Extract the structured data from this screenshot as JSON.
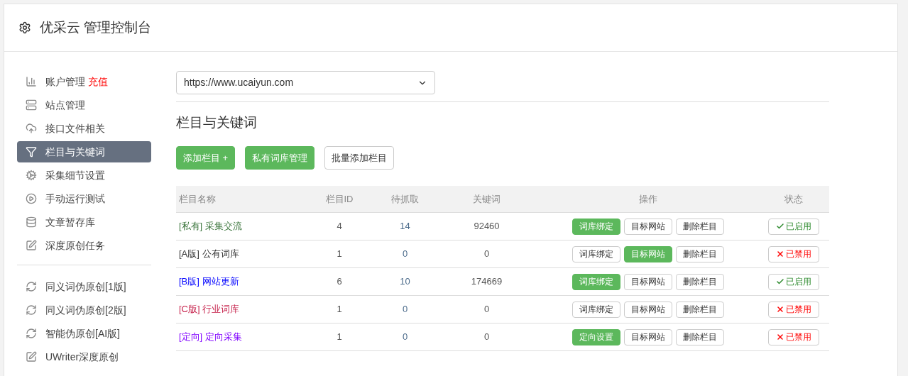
{
  "header": {
    "title": "优采云 管理控制台"
  },
  "sidebar": {
    "groups": [
      {
        "items": [
          {
            "label": "账户管理",
            "badge": "充值",
            "selected": false
          },
          {
            "label": "站点管理",
            "selected": false
          },
          {
            "label": "接口文件相关",
            "selected": false
          },
          {
            "label": "栏目与关键词",
            "selected": true
          },
          {
            "label": "采集细节设置",
            "selected": false
          },
          {
            "label": "手动运行测试",
            "selected": false
          },
          {
            "label": "文章暂存库",
            "selected": false
          },
          {
            "label": "深度原创任务",
            "selected": false
          }
        ]
      },
      {
        "items": [
          {
            "label": "同义词伪原创[1版]",
            "selected": false
          },
          {
            "label": "同义词伪原创[2版]",
            "selected": false
          },
          {
            "label": "智能伪原创[AI版]",
            "selected": false
          },
          {
            "label": "UWriter深度原创",
            "selected": false
          }
        ]
      }
    ]
  },
  "site_select": {
    "value": "https://www.ucaiyun.com"
  },
  "section_title": "栏目与关键词",
  "toolbar": [
    {
      "label": "添加栏目 +",
      "kind": "primary"
    },
    {
      "label": "私有词库管理",
      "kind": "primary"
    },
    {
      "label": "批量添加栏目",
      "kind": "default"
    }
  ],
  "table": {
    "column_headers": {
      "column_1": "栏目名称",
      "column_2": "栏目ID",
      "column_3": "待抓取",
      "column_4": "关键词",
      "column_5": "操作",
      "column_6": "状态"
    },
    "rows": [
      {
        "tag": "[私有]",
        "name": "采集交流",
        "color": "#3c763d",
        "id": "4",
        "pending": "14",
        "keywords": "92460",
        "actions": [
          {
            "label": "词库绑定",
            "highlighted": true
          },
          {
            "label": "目标网站",
            "highlighted": false
          },
          {
            "label": "删除栏目",
            "highlighted": false
          }
        ],
        "enabled": true,
        "status": "已启用"
      },
      {
        "tag": "[A版]",
        "name": "公有词库",
        "color": "#333333",
        "id": "1",
        "pending": "0",
        "keywords": "0",
        "actions": [
          {
            "label": "词库绑定",
            "highlighted": false
          },
          {
            "label": "目标网站",
            "highlighted": true
          },
          {
            "label": "删除栏目",
            "highlighted": false
          }
        ],
        "enabled": false,
        "status": "已禁用"
      },
      {
        "tag": "[B版]",
        "name": "网站更新",
        "color": "#0000ff",
        "id": "6",
        "pending": "10",
        "keywords": "174669",
        "actions": [
          {
            "label": "词库绑定",
            "highlighted": true
          },
          {
            "label": "目标网站",
            "highlighted": false
          },
          {
            "label": "删除栏目",
            "highlighted": false
          }
        ],
        "enabled": true,
        "status": "已启用"
      },
      {
        "tag": "[C版]",
        "name": "行业词库",
        "color": "#c7254e",
        "id": "1",
        "pending": "0",
        "keywords": "0",
        "actions": [
          {
            "label": "词库绑定",
            "highlighted": false
          },
          {
            "label": "目标网站",
            "highlighted": false
          },
          {
            "label": "删除栏目",
            "highlighted": false
          }
        ],
        "enabled": false,
        "status": "已禁用"
      },
      {
        "tag": "[定向]",
        "name": "定向采集",
        "color": "#8000ff",
        "id": "1",
        "pending": "0",
        "keywords": "0",
        "actions": [
          {
            "label": "定向设置",
            "highlighted": true
          },
          {
            "label": "目标网站",
            "highlighted": false
          },
          {
            "label": "删除栏目",
            "highlighted": false
          }
        ],
        "enabled": false,
        "status": "已禁用"
      }
    ]
  }
}
